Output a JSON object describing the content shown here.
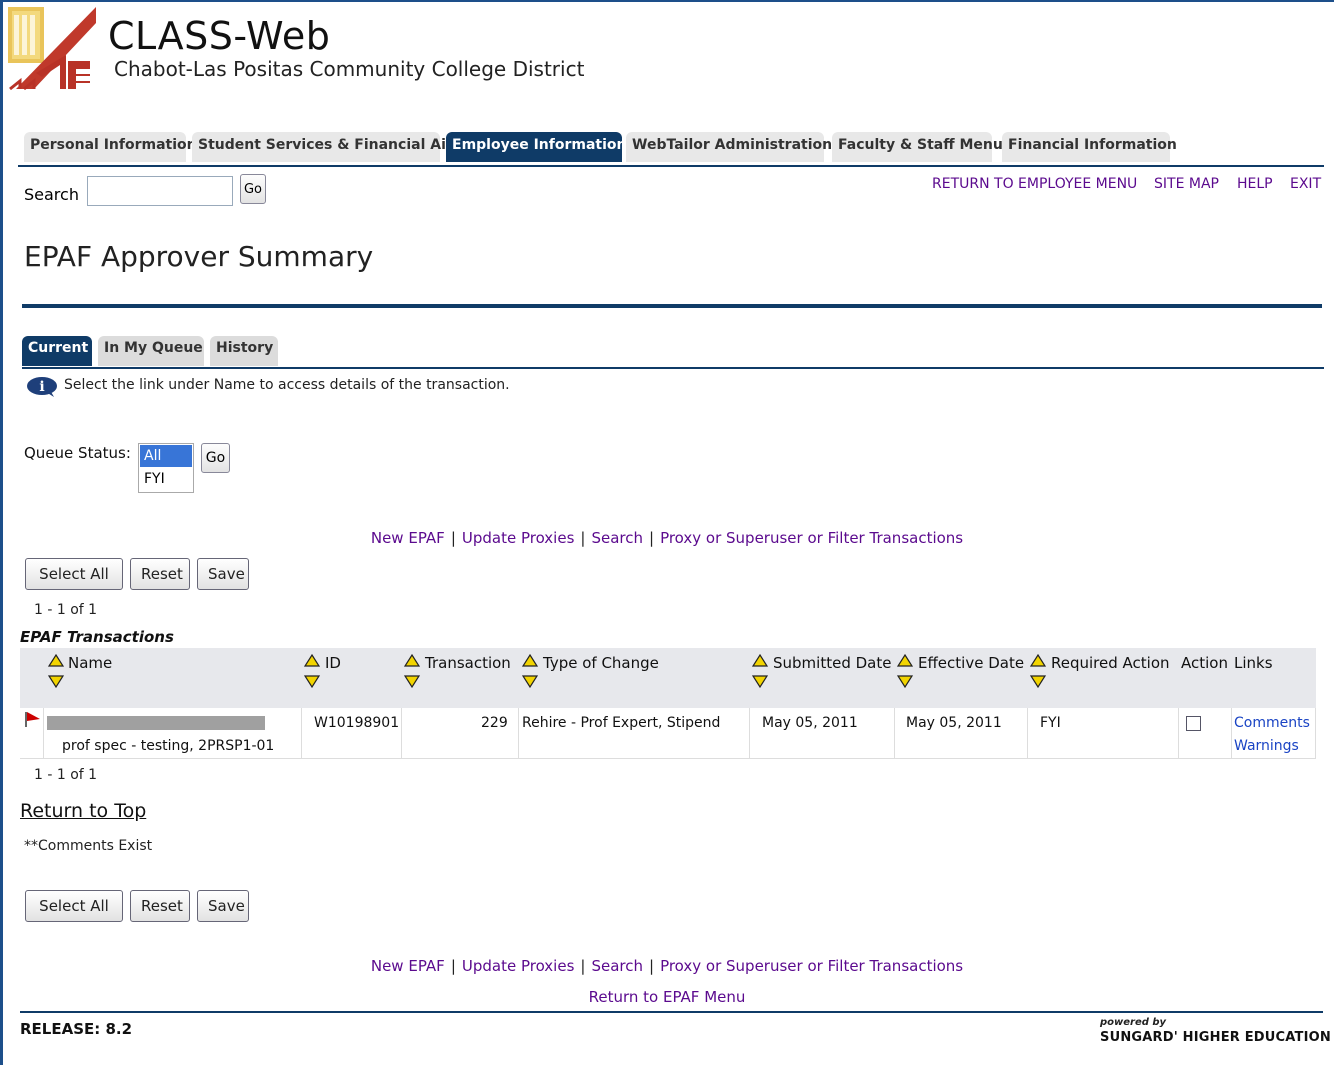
{
  "header": {
    "app_title": "CLASS-Web",
    "app_subtitle": "Chabot-Las Positas Community College District"
  },
  "main_tabs": [
    {
      "label": "Personal Information",
      "active": false
    },
    {
      "label": "Student Services & Financial Aid",
      "active": false
    },
    {
      "label": "Employee Information",
      "active": true
    },
    {
      "label": "WebTailor Administration",
      "active": false
    },
    {
      "label": "Faculty & Staff Menu",
      "active": false
    },
    {
      "label": "Financial Information",
      "active": false
    }
  ],
  "search": {
    "label": "Search",
    "value": "",
    "go_label": "Go"
  },
  "top_links": [
    "RETURN TO EMPLOYEE MENU",
    "SITE MAP",
    "HELP",
    "EXIT"
  ],
  "page_title": "EPAF Approver Summary",
  "sub_tabs": [
    {
      "label": "Current",
      "active": true
    },
    {
      "label": "In My Queue",
      "active": false
    },
    {
      "label": "History",
      "active": false
    }
  ],
  "info_text": "Select the link under Name to access details of the transaction.",
  "queue_status": {
    "label": "Queue Status:",
    "options": [
      "All",
      "FYI"
    ],
    "selected": "All",
    "go_label": "Go"
  },
  "action_links": [
    "New EPAF",
    "Update Proxies",
    "Search",
    "Proxy or Superuser or Filter Transactions"
  ],
  "buttons": {
    "select_all": "Select All",
    "reset": "Reset",
    "save": "Save"
  },
  "record_count": "1 - 1 of 1",
  "table": {
    "caption": "EPAF Transactions",
    "columns": [
      "Name",
      "ID",
      "Transaction",
      "Type of Change",
      "Submitted Date",
      "Effective Date",
      "Required Action",
      "Action",
      "Links"
    ],
    "rows": [
      {
        "name_detail": "prof spec - testing, 2PRSP1-01",
        "id": "W10198901",
        "transaction": "229",
        "type_of_change": "Rehire - Prof Expert, Stipend",
        "submitted_date": "May 05, 2011",
        "effective_date": "May 05, 2011",
        "required_action": "FYI",
        "action_checked": false,
        "links": [
          "Comments",
          "Warnings"
        ]
      }
    ]
  },
  "return_to_top": "Return to Top",
  "comments_note": "**Comments Exist",
  "return_to_epaf_menu": "Return to EPAF Menu",
  "footer": {
    "release": "RELEASE: 8.2",
    "powered_by": "powered by",
    "vendor": "SUNGARD' HIGHER EDUCATION"
  },
  "colors": {
    "nav_blue": "#0f3b67",
    "link_purple": "#5b0a8e",
    "link_blue": "#1a44c4",
    "flag_red": "#cc0000",
    "sort_yellow": "#f2d400"
  }
}
